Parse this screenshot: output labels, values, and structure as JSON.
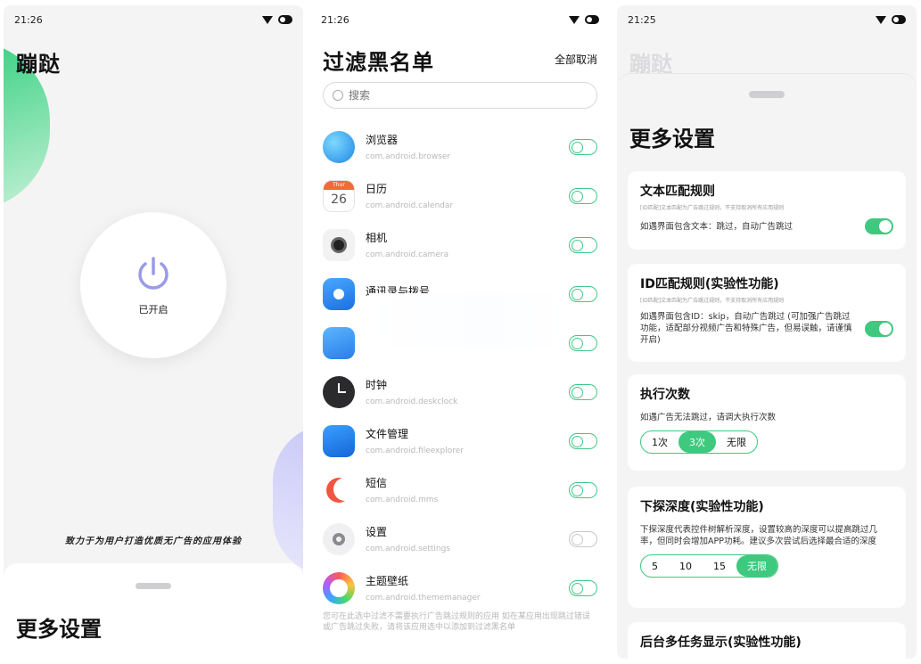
{
  "screen1": {
    "time": "21:26",
    "title": "蹦跶",
    "power_label": "已开启",
    "tagline": "致力于为用户打造优质无广告的应用体验",
    "more_settings": "更多设置"
  },
  "screen2": {
    "time": "21:26",
    "title": "过滤黑名单",
    "deselect_all": "全部取消",
    "search_placeholder": "搜索",
    "apps": [
      {
        "name": "浏览器",
        "package": "com.android.browser",
        "icon": "browser-icon"
      },
      {
        "name": "日历",
        "package": "com.android.calendar",
        "icon": "calendar-icon",
        "icon_text": "26",
        "icon_small": "Thur"
      },
      {
        "name": "相机",
        "package": "com.android.camera",
        "icon": "camera-icon"
      },
      {
        "name": "通讯录与拨号",
        "package": "",
        "icon": "contacts-icon"
      },
      {
        "name": "",
        "package": "",
        "icon": "messages-icon"
      },
      {
        "name": "时钟",
        "package": "com.android.deskclock",
        "icon": "clock-icon"
      },
      {
        "name": "文件管理",
        "package": "com.android.fileexplorer",
        "icon": "folder-icon"
      },
      {
        "name": "短信",
        "package": "com.android.mms",
        "icon": "sms-icon"
      },
      {
        "name": "设置",
        "package": "com.android.settings",
        "icon": "settings-icon"
      },
      {
        "name": "主题壁纸",
        "package": "com.android.thememanager",
        "icon": "theme-icon"
      }
    ],
    "footer_note": "您可在此选中过滤不需要执行广告跳过规则的应用 如在某应用出现跳过错误或广告跳过失败，请将该应用选中以添加到过滤黑名单"
  },
  "screen3": {
    "time": "21:25",
    "ghost_title": "蹦跶",
    "title": "更多设置",
    "text_rule": {
      "title": "文本匹配规则",
      "note": "[ID匹配]文本匹配为广告跳过规则，不支持取消所有应用规则",
      "desc": "如遇界面包含文本：跳过，自动广告跳过"
    },
    "id_rule": {
      "title": "ID匹配规则(实验性功能)",
      "note": "[ID匹配]文本匹配为广告跳过规则，不支持取消所有应用规则",
      "desc": "如遇界面包含ID：skip，自动广告跳过 (可加强广告跳过功能，适配部分视频广告和特殊广告，但易误触，请谨慎开启)"
    },
    "exec_count": {
      "title": "执行次数",
      "desc": "如遇广告无法跳过，请调大执行次数",
      "options": [
        "1次",
        "3次",
        "无限"
      ],
      "selected": "3次"
    },
    "depth": {
      "title": "下探深度(实验性功能)",
      "desc": "下探深度代表控件树解析深度，设置较高的深度可以提高跳过几率，但同时会增加APP功耗。建议多次尝试后选择最合适的深度",
      "options": [
        "5",
        "10",
        "15",
        "无限"
      ],
      "selected": "无限"
    },
    "multitask": {
      "title": "后台多任务显示(实验性功能)"
    }
  },
  "colors": {
    "accent_green": "#3ec97f",
    "power_purple": "#9a9ae8"
  }
}
